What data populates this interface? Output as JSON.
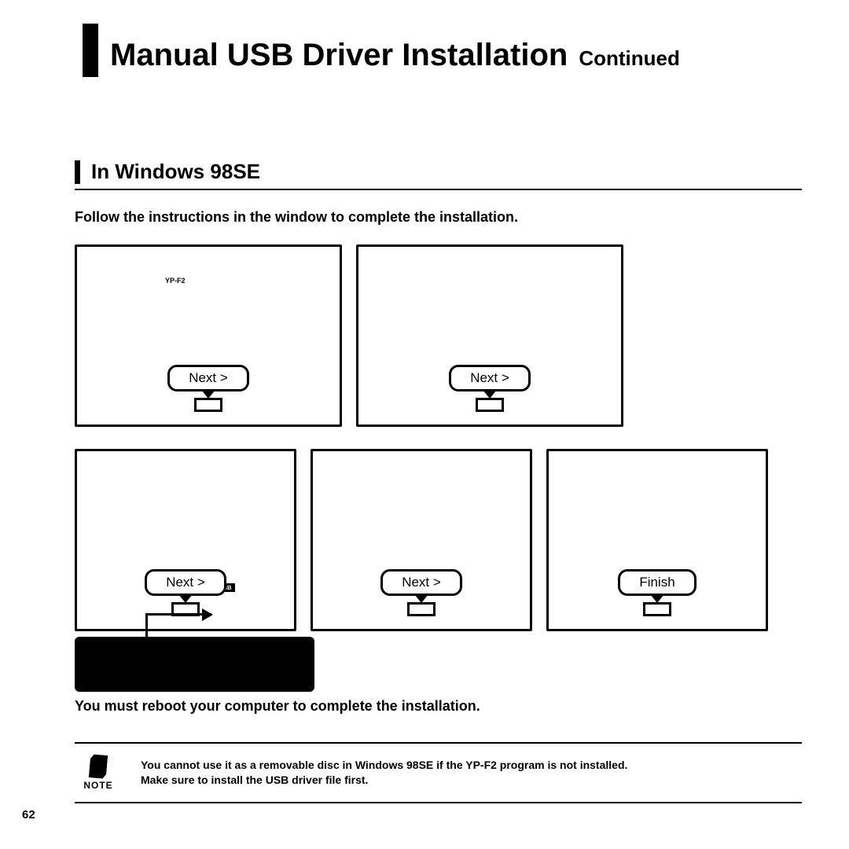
{
  "title": {
    "main": "Manual USB Driver Installation",
    "sub": "Continued"
  },
  "section_title": "In Windows 98SE",
  "instruction": "Follow the instructions in the window to complete the installation.",
  "dialogs": {
    "row1": [
      {
        "label": "Next >",
        "tiny": "YP-F2"
      },
      {
        "label": "Next >"
      }
    ],
    "row2": [
      {
        "label": "Next >",
        "path": "\\USB Driver\\win98 USB"
      },
      {
        "label": "Next >"
      },
      {
        "label": "Finish"
      }
    ]
  },
  "reboot": "You must reboot your computer to complete the installation.",
  "note": {
    "label": "NOTE",
    "lines": [
      "You cannot use it as a removable disc in Windows 98SE if the YP-F2 program is not installed.",
      "Make sure to install the USB driver file first."
    ]
  },
  "page_number": "62"
}
